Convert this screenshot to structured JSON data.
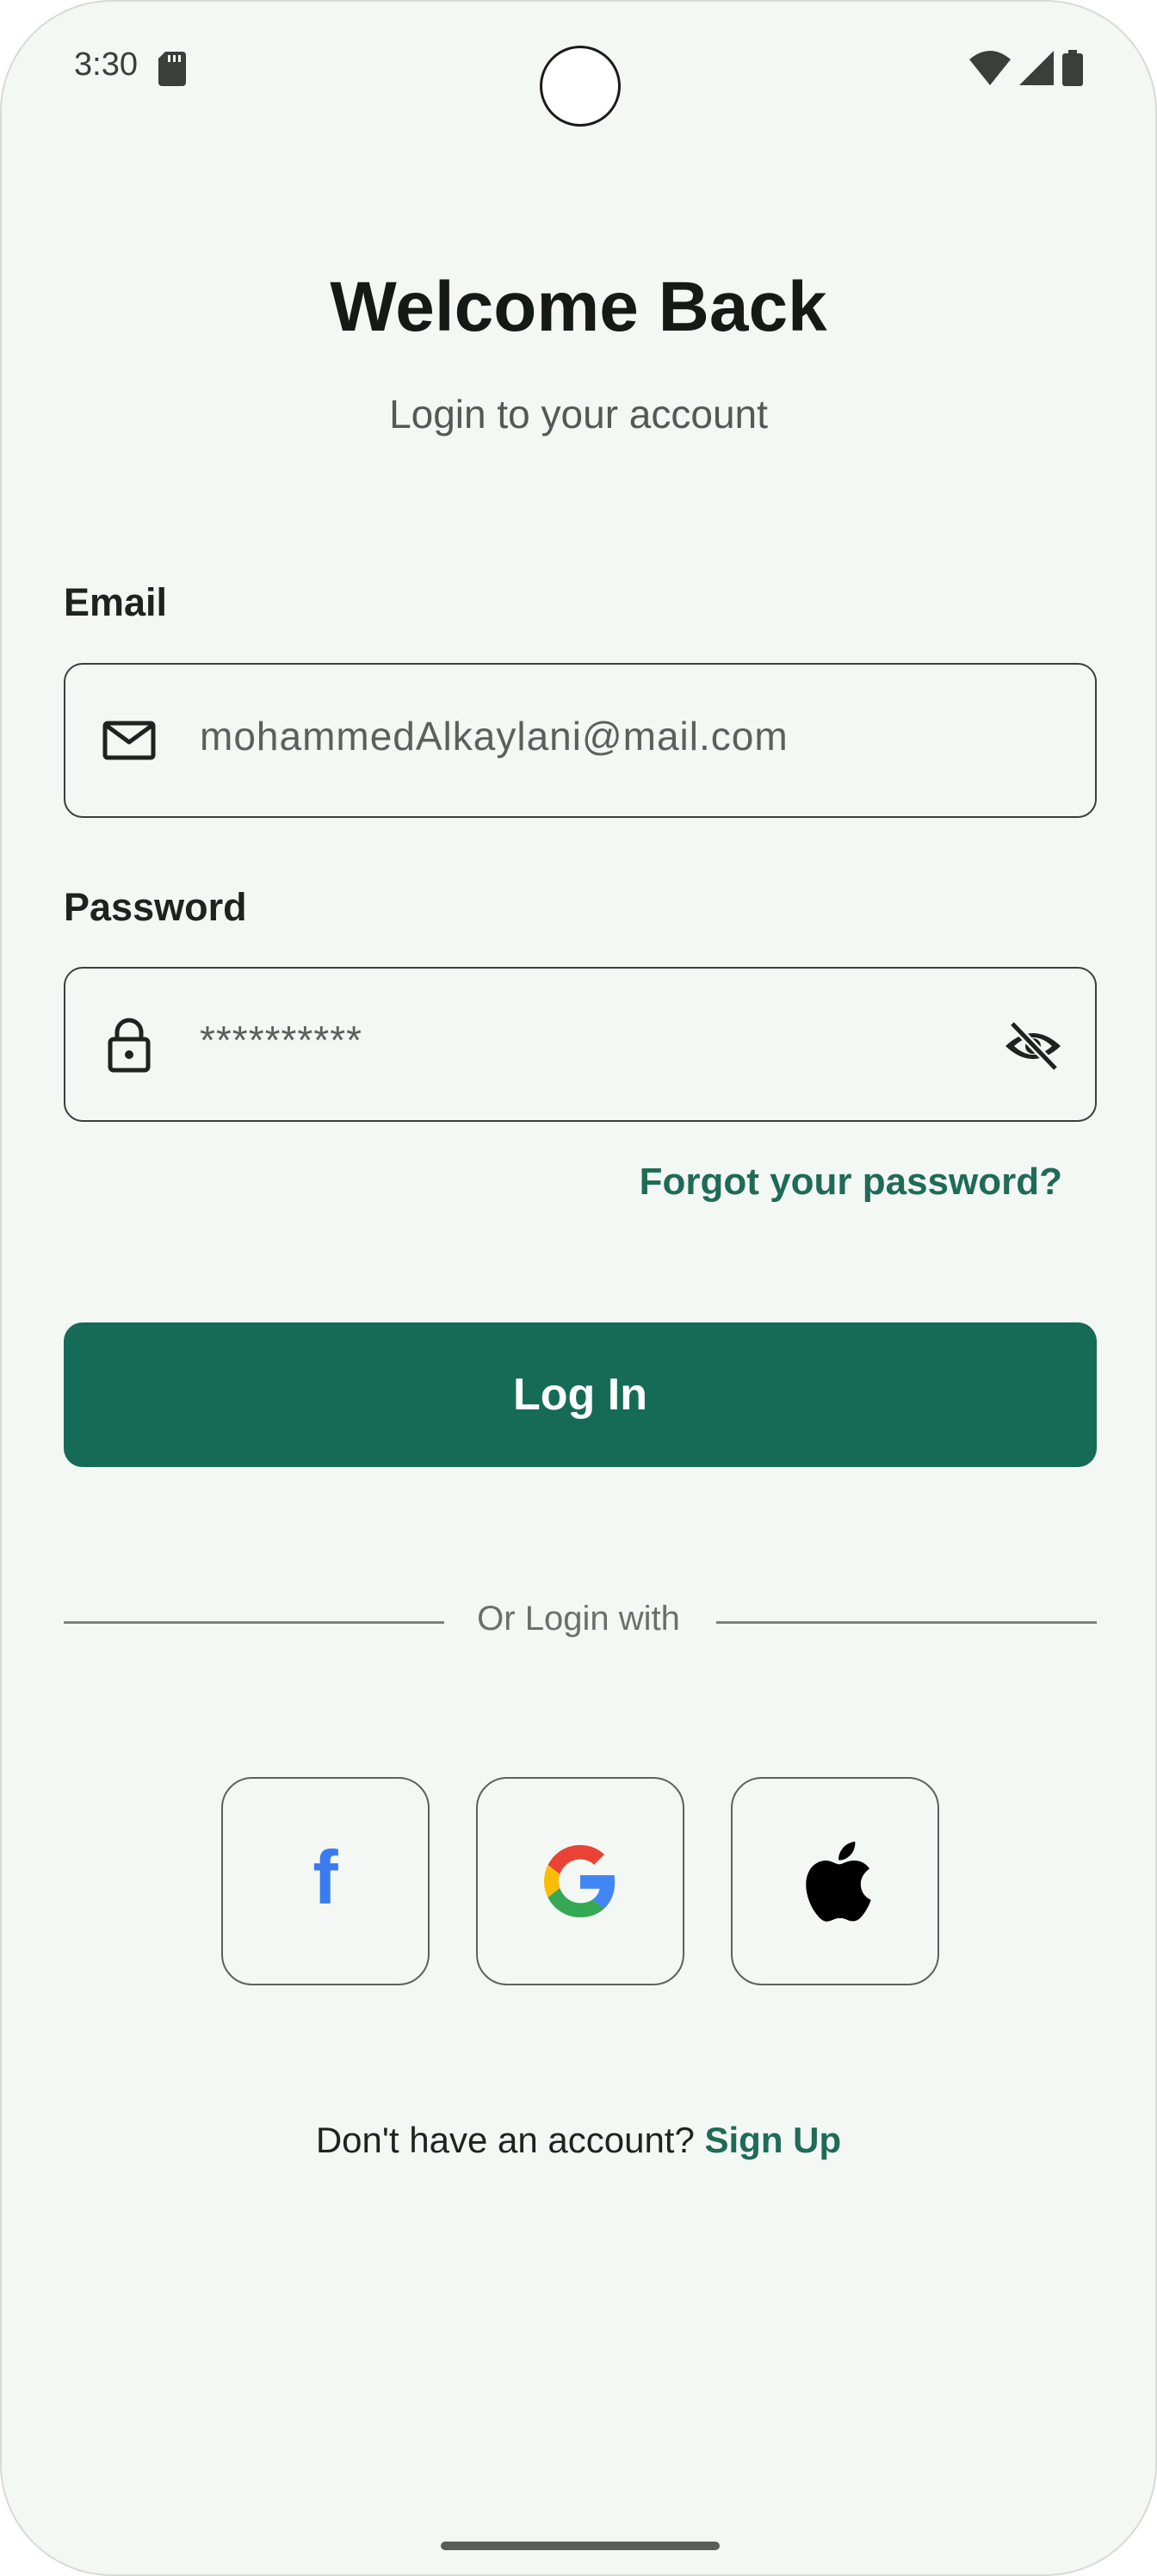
{
  "status_bar": {
    "time": "3:30"
  },
  "header": {
    "title": "Welcome Back",
    "subtitle": "Login to your account"
  },
  "email": {
    "label": "Email",
    "value": "mohammedAlkaylani@mail.com"
  },
  "password": {
    "label": "Password",
    "value": "**********"
  },
  "forgot_password": "Forgot your password?",
  "login_button": "Log In",
  "divider_text": "Or Login with",
  "social": {
    "facebook_glyph": "f",
    "google_glyph": "G"
  },
  "signup": {
    "prompt": "Don't have an account?",
    "link": "Sign Up"
  },
  "colors": {
    "background": "#F3F8F4",
    "primary": "#166B57",
    "link": "#1F6B57",
    "facebook": "#3B7BF0"
  },
  "icons": [
    "sd-card-icon",
    "wifi-icon",
    "signal-icon",
    "battery-icon",
    "mail-icon",
    "lock-icon",
    "eye-off-icon",
    "facebook-icon",
    "google-icon",
    "apple-icon"
  ]
}
